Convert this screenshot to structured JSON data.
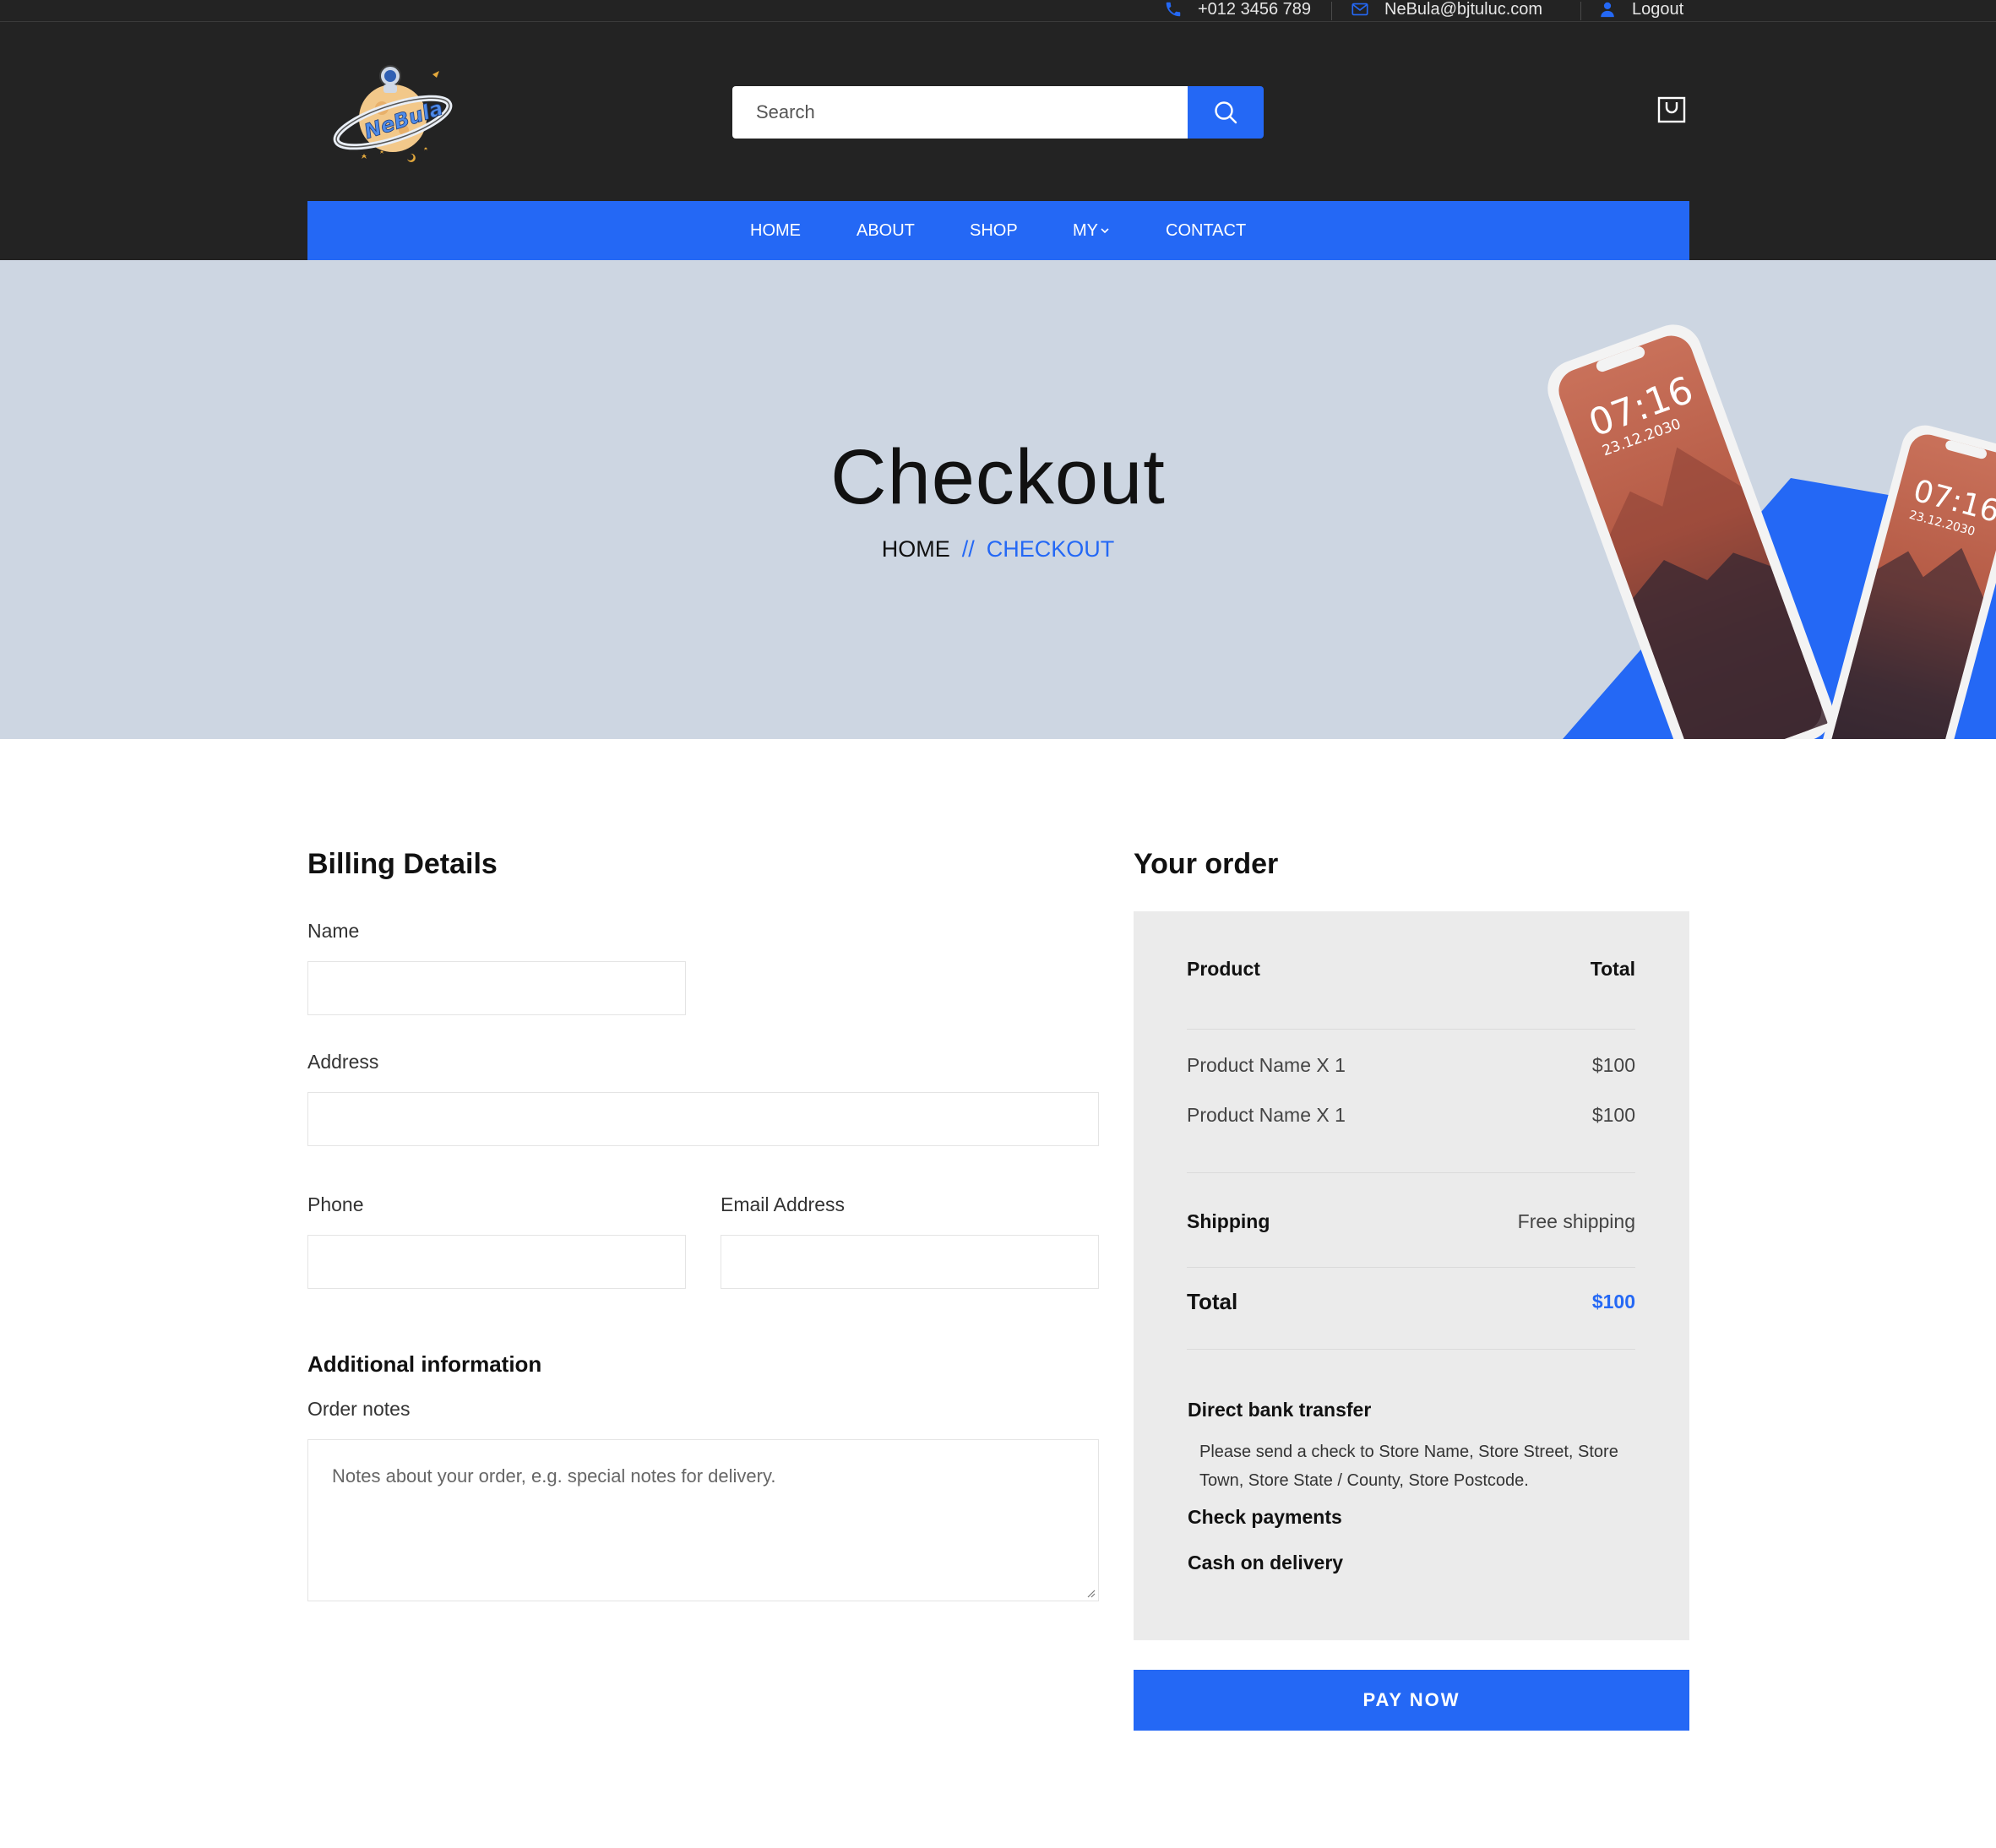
{
  "topbar": {
    "phone": "+012 3456 789",
    "email": "NeBula@bjtuluc.com",
    "logout": "Logout"
  },
  "header": {
    "logo_alt": "NeBula",
    "search_placeholder": "Search"
  },
  "nav": {
    "items": [
      {
        "label": "HOME"
      },
      {
        "label": "ABOUT"
      },
      {
        "label": "SHOP"
      },
      {
        "label": "MY"
      },
      {
        "label": "CONTACT"
      }
    ]
  },
  "hero": {
    "title": "Checkout",
    "breadcrumb_home": "HOME",
    "breadcrumb_sep": "//",
    "breadcrumb_current": "CHECKOUT",
    "phone_time": "07:16",
    "phone_date": "23.12.2030"
  },
  "billing": {
    "title": "Billing Details",
    "name_label": "Name",
    "address_label": "Address",
    "phone_label": "Phone",
    "email_label": "Email Address",
    "additional_title": "Additional information",
    "notes_label": "Order notes",
    "notes_placeholder": "Notes about your order, e.g. special notes for delivery."
  },
  "order": {
    "title": "Your order",
    "col_product": "Product",
    "col_total": "Total",
    "items": [
      {
        "name": "Product Name X 1",
        "price": "$100"
      },
      {
        "name": "Product Name X 1",
        "price": "$100"
      }
    ],
    "shipping_label": "Shipping",
    "shipping_value": "Free shipping",
    "total_label": "Total",
    "total_value": "$100",
    "payment_methods": [
      {
        "label": "Direct bank transfer",
        "description": "Please send a check to Store Name, Store Street, Store Town, Store State / County, Store Postcode."
      },
      {
        "label": "Check payments"
      },
      {
        "label": "Cash on delivery"
      }
    ],
    "pay_button": "PAY NOW"
  },
  "colors": {
    "accent": "#2468f5",
    "header_bg": "#232323",
    "hero_bg": "#cdd6e2",
    "order_bg": "#ebebeb"
  }
}
